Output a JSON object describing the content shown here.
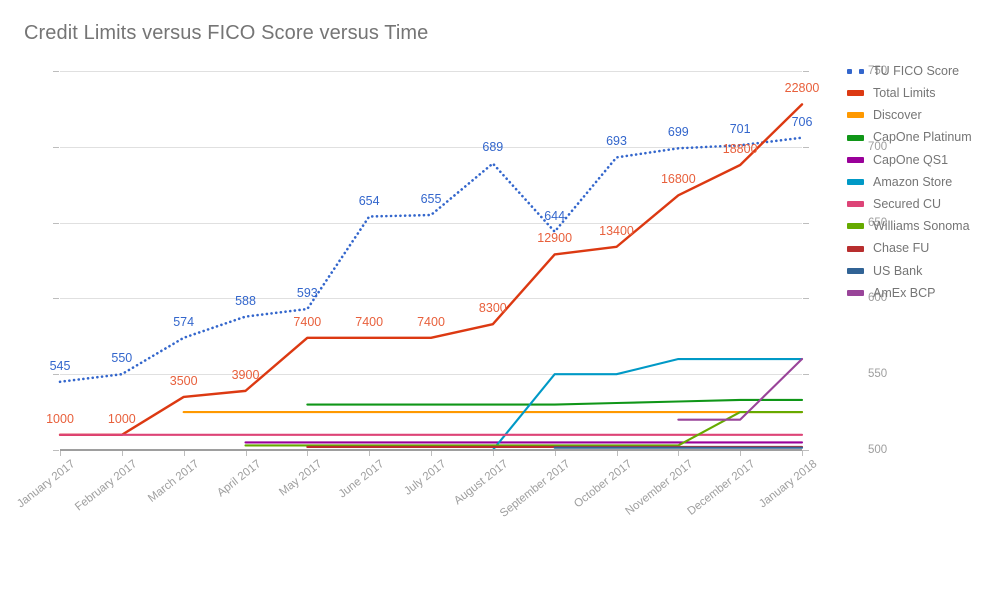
{
  "chart_data": {
    "type": "line",
    "title": "Credit Limits versus FICO Score versus Time",
    "xlabel": "",
    "ylabel": "",
    "grid": true,
    "legend_position": "right",
    "categories": [
      "January 2017",
      "February 2017",
      "March 2017",
      "April 2017",
      "May 2017",
      "June 2017",
      "July 2017",
      "August 2017",
      "September 2017",
      "October 2017",
      "November 2017",
      "December 2017",
      "January 2018"
    ],
    "axes": {
      "left": {
        "label": "",
        "min": 0,
        "max": 25000,
        "step": 5000,
        "ticks": [
          "0",
          "5000",
          "10000",
          "15000",
          "20000",
          "25000"
        ]
      },
      "right": {
        "label": "",
        "min": 500,
        "max": 750,
        "step": 50,
        "ticks": [
          "500",
          "550",
          "600",
          "650",
          "700",
          "750"
        ]
      }
    },
    "series": [
      {
        "name": "TU FICO Score",
        "color": "#3366cc",
        "style": "dotted",
        "axis": "right",
        "values": [
          545,
          550,
          574,
          588,
          593,
          654,
          655,
          689,
          644,
          693,
          699,
          701,
          706
        ],
        "labels": [
          "545",
          "550",
          "574",
          "588",
          "593",
          "654",
          "655",
          "689",
          "644",
          "693",
          "699",
          "701",
          "706"
        ]
      },
      {
        "name": "Total Limits",
        "color": "#dc3912",
        "style": "solid",
        "axis": "left",
        "values": [
          1000,
          1000,
          3500,
          3900,
          7400,
          7400,
          7400,
          8300,
          12900,
          13400,
          16800,
          18800,
          22800
        ],
        "labels": [
          "1000",
          "1000",
          "3500",
          "3900",
          "7400",
          "7400",
          "7400",
          "8300",
          "12900",
          "13400",
          "16800",
          "18800",
          "22800"
        ]
      },
      {
        "name": "Discover",
        "color": "#ff9900",
        "style": "solid",
        "axis": "left",
        "values": [
          null,
          null,
          2500,
          2500,
          2500,
          2500,
          2500,
          2500,
          2500,
          2500,
          2500,
          2500,
          2500
        ]
      },
      {
        "name": "CapOne Platinum",
        "color": "#109618",
        "style": "solid",
        "axis": "left",
        "values": [
          null,
          null,
          null,
          null,
          3000,
          3000,
          3000,
          3000,
          3000,
          3100,
          3200,
          3300,
          3300
        ]
      },
      {
        "name": "CapOne QS1",
        "color": "#990099",
        "style": "solid",
        "axis": "left",
        "values": [
          null,
          null,
          null,
          500,
          500,
          500,
          500,
          500,
          500,
          500,
          500,
          500,
          500
        ]
      },
      {
        "name": "Amazon Store",
        "color": "#0099c6",
        "style": "solid",
        "axis": "left",
        "values": [
          null,
          null,
          null,
          null,
          null,
          null,
          null,
          0,
          5000,
          5000,
          6000,
          6000,
          6000
        ]
      },
      {
        "name": "Secured CU",
        "color": "#dd4477",
        "style": "solid",
        "axis": "left",
        "values": [
          1000,
          1000,
          1000,
          1000,
          1000,
          1000,
          1000,
          1000,
          1000,
          1000,
          1000,
          1000,
          1000
        ]
      },
      {
        "name": "Williams Sonoma",
        "color": "#66aa00",
        "style": "solid",
        "axis": "left",
        "values": [
          null,
          null,
          null,
          300,
          300,
          300,
          300,
          300,
          300,
          300,
          300,
          2500,
          2500
        ]
      },
      {
        "name": "Chase FU",
        "color": "#b82e2e",
        "style": "solid",
        "axis": "left",
        "values": [
          null,
          null,
          null,
          null,
          200,
          200,
          200,
          200,
          200,
          200,
          200,
          200,
          200
        ]
      },
      {
        "name": "US Bank",
        "color": "#316395",
        "style": "solid",
        "axis": "left",
        "values": [
          null,
          null,
          null,
          null,
          null,
          null,
          null,
          null,
          150,
          150,
          150,
          150,
          150
        ]
      },
      {
        "name": "AmEx BCP",
        "color": "#994499",
        "style": "solid",
        "axis": "left",
        "values": [
          null,
          null,
          null,
          null,
          null,
          null,
          null,
          null,
          null,
          null,
          2000,
          2000,
          6000
        ]
      }
    ]
  },
  "header": {
    "title": "Credit Limits versus FICO Score versus Time"
  },
  "legend": {
    "items": [
      {
        "label": "TU FICO Score",
        "color": "#3366cc",
        "style": "dotted"
      },
      {
        "label": "Total Limits",
        "color": "#dc3912",
        "style": "solid"
      },
      {
        "label": "Discover",
        "color": "#ff9900",
        "style": "solid"
      },
      {
        "label": "CapOne Platinum",
        "color": "#109618",
        "style": "solid"
      },
      {
        "label": "CapOne QS1",
        "color": "#990099",
        "style": "solid"
      },
      {
        "label": "Amazon Store",
        "color": "#0099c6",
        "style": "solid"
      },
      {
        "label": "Secured CU",
        "color": "#dd4477",
        "style": "solid"
      },
      {
        "label": "Williams Sonoma",
        "color": "#66aa00",
        "style": "solid"
      },
      {
        "label": "Chase FU",
        "color": "#b82e2e",
        "style": "solid"
      },
      {
        "label": "US Bank",
        "color": "#316395",
        "style": "solid"
      },
      {
        "label": "AmEx BCP",
        "color": "#994499",
        "style": "solid"
      }
    ]
  }
}
